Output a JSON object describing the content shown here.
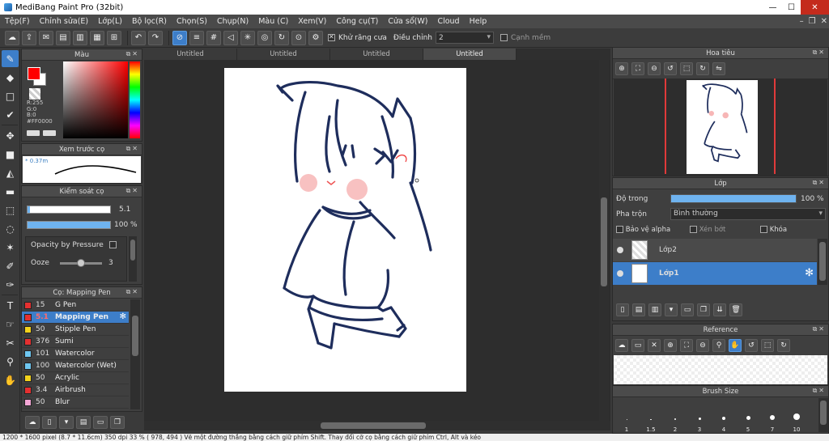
{
  "window": {
    "title": "MediBang Paint Pro (32bit)"
  },
  "menu": [
    "Tệp(F)",
    "Chỉnh sửa(E)",
    "Lớp(L)",
    "Bộ lọc(R)",
    "Chọn(S)",
    "Chụp(N)",
    "Màu (C)",
    "Xem(V)",
    "Công cụ(T)",
    "Cửa sổ(W)",
    "Cloud",
    "Help"
  ],
  "toolbar": {
    "antialias_label": "Khử răng cưa",
    "adjust_label": "Điều chỉnh",
    "adjust_value": "2",
    "edge_label": "Cạnh mềm"
  },
  "color_panel": {
    "title": "Màu",
    "r": "R:255",
    "g": "G:0",
    "b": "B:0",
    "hex": "#FF0000",
    "foreground": "#ff0000"
  },
  "brush_preview": {
    "title": "Xem trước cọ",
    "size": "0.37m"
  },
  "brush_control": {
    "title": "Kiểm soát cọ",
    "size_value": "5.1",
    "size_fraction": 0.03,
    "opacity_value": "100 %",
    "opacity_fraction": 1.0,
    "pressure_label": "Opacity by Pressure",
    "ooze_label": "Ooze",
    "ooze_value": "3",
    "ooze_fraction": 0.5
  },
  "brush_list": {
    "title": "Cọ: Mapping Pen",
    "items": [
      {
        "size": "15",
        "name": "G Pen",
        "color": "#e53030",
        "selected": false
      },
      {
        "size": "5.1",
        "name": "Mapping Pen",
        "color": "#e53030",
        "selected": true
      },
      {
        "size": "50",
        "name": "Stipple Pen",
        "color": "#f2d21b",
        "selected": false
      },
      {
        "size": "376",
        "name": "Sumi",
        "color": "#e53030",
        "selected": false
      },
      {
        "size": "101",
        "name": "Watercolor",
        "color": "#6ec6f0",
        "selected": false
      },
      {
        "size": "100",
        "name": "Watercolor (Wet)",
        "color": "#6ec6f0",
        "selected": false
      },
      {
        "size": "50",
        "name": "Acrylic",
        "color": "#f2d21b",
        "selected": false
      },
      {
        "size": "3.4",
        "name": "Airbrush",
        "color": "#e53030",
        "selected": false
      },
      {
        "size": "50",
        "name": "Blur",
        "color": "#f4a6d6",
        "selected": false
      }
    ]
  },
  "tabs": [
    "Untitled",
    "Untitled",
    "Untitled",
    "Untitled"
  ],
  "navigator": {
    "title": "Hoa tiêu"
  },
  "layers": {
    "title": "Lớp",
    "opacity_label": "Độ trong",
    "opacity_value": "100 %",
    "opacity_fraction": 1.0,
    "blend_label": "Pha trộn",
    "blend_value": "Bình thường",
    "protect_alpha": "Bảo vệ alpha",
    "clipping": "Xén bớt",
    "lock": "Khóa",
    "items": [
      {
        "name": "Lớp2",
        "selected": false
      },
      {
        "name": "Lớp1",
        "selected": true
      }
    ]
  },
  "reference": {
    "title": "Reference"
  },
  "brush_size": {
    "title": "Brush Size",
    "sizes": [
      "1",
      "1.5",
      "2",
      "3",
      "4",
      "5",
      "7",
      "10"
    ]
  },
  "status": {
    "text": "1200 * 1600 pixel   (8.7 * 11.6cm)   350 dpi   33 %   ( 978, 494 )   Vẽ một đường thẳng bằng cách giữ phím Shift. Thay đổi cỡ cọ bằng cách giữ phím Ctrl, Alt và kéo"
  }
}
